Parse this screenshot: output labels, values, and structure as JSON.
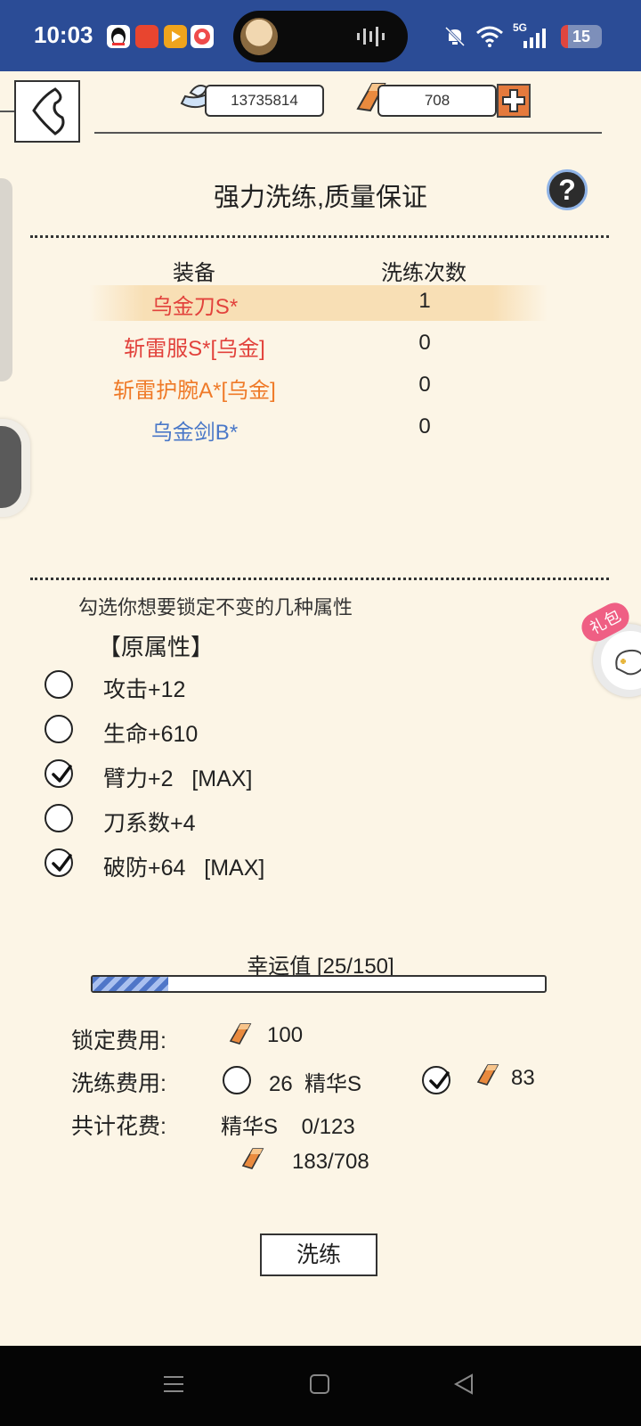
{
  "status_bar": {
    "time": "10:03",
    "network": "5G",
    "battery": "15",
    "icons": [
      "qq-icon",
      "app-icon",
      "video-app-icon",
      "game-app-icon",
      "mute-icon",
      "wifi-icon",
      "signal-icon",
      "battery-icon"
    ]
  },
  "currency": {
    "silver": "13735814",
    "gold": "708"
  },
  "title": "强力洗练,质量保证",
  "help": "?",
  "table": {
    "headers": [
      "装备",
      "洗练次数"
    ],
    "rows": [
      {
        "name": "乌金刀S*",
        "count": "1",
        "color": "#e2423c",
        "selected": true
      },
      {
        "name": "斩雷服S*[乌金]",
        "count": "0",
        "color": "#e2423c",
        "selected": false
      },
      {
        "name": "斩雷护腕A*[乌金]",
        "count": "0",
        "color": "#ef7a28",
        "selected": false
      },
      {
        "name": "乌金剑B*",
        "count": "0",
        "color": "#4a78c8",
        "selected": false
      }
    ]
  },
  "lock_hint": "勾选你想要锁定不变的几种属性",
  "original_attributes_label": "【原属性】",
  "attributes": [
    {
      "label": "攻击+12",
      "checked": false
    },
    {
      "label": "生命+610",
      "checked": false
    },
    {
      "label": "臂力+2   [MAX]",
      "checked": true
    },
    {
      "label": "刀系数+4",
      "checked": false
    },
    {
      "label": "破防+64   [MAX]",
      "checked": true
    }
  ],
  "luck": {
    "label": "幸运值 [25/150]",
    "value": 25,
    "max": 150
  },
  "costs": {
    "lock_label": "锁定费用:",
    "lock_amount": "100",
    "refine_label": "洗练费用:",
    "refine_essence": "26  精华S",
    "refine_essence_checked": false,
    "refine_gold": "83",
    "refine_gold_checked": true,
    "total_label": "共计花费:",
    "total_essence": "精华S    0/123",
    "total_gold": "183/708"
  },
  "refine_button": "洗练",
  "gift_tag": "礼包",
  "colors": {
    "background": "#fcf5e6",
    "status_bar": "#2b4c96",
    "accent_gold": "#e98a3e",
    "luck_fill": "#4f76c8"
  }
}
